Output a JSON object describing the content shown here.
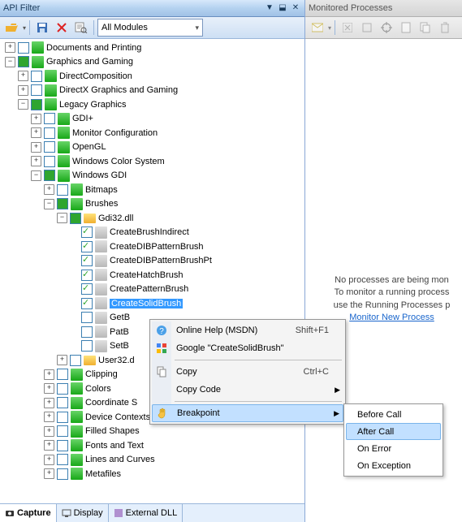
{
  "left": {
    "title": "API Filter",
    "combo": "All Modules",
    "tabs": {
      "capture": "Capture",
      "display": "Display",
      "external": "External DLL"
    }
  },
  "right": {
    "title": "Monitored Processes",
    "info": {
      "line1": "No processes are being mon",
      "line2": "To monitor a running process",
      "line3": "use the Running Processes p",
      "link": "Monitor New Process"
    }
  },
  "tree": {
    "docs": "Documents and Printing",
    "gg": "Graphics and Gaming",
    "dc": "DirectComposition",
    "dx": "DirectX Graphics and Gaming",
    "lg": "Legacy Graphics",
    "gdiplus": "GDI+",
    "moncfg": "Monitor Configuration",
    "opengl": "OpenGL",
    "wcs": "Windows Color System",
    "wgdi": "Windows GDI",
    "bitmaps": "Bitmaps",
    "brushes": "Brushes",
    "gdi32": "Gdi32.dll",
    "cbi": "CreateBrushIndirect",
    "cdpb": "CreateDIBPatternBrush",
    "cdpbpt": "CreateDIBPatternBrushPt",
    "chb": "CreateHatchBrush",
    "cpb": "CreatePatternBrush",
    "csb": "CreateSolidBrush",
    "get": "GetB",
    "pat": "PatB",
    "set": "SetB",
    "user32": "User32.d",
    "clip": "Clipping",
    "colors": "Colors",
    "coords": "Coordinate S",
    "dctx": "Device Contexts",
    "fshapes": "Filled Shapes",
    "ftext": "Fonts and Text",
    "lcurves": "Lines and Curves",
    "meta": "Metafiles"
  },
  "menu": {
    "help": "Online Help (MSDN)",
    "help_sc": "Shift+F1",
    "google": "Google \"CreateSolidBrush\"",
    "copy": "Copy",
    "copy_sc": "Ctrl+C",
    "copycode": "Copy Code",
    "breakpoint": "Breakpoint"
  },
  "submenu": {
    "before": "Before Call",
    "after": "After Call",
    "onerror": "On Error",
    "onexc": "On Exception"
  }
}
